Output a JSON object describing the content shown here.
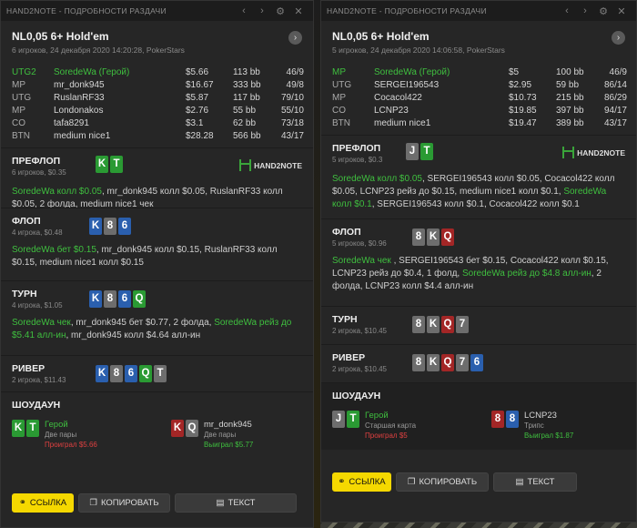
{
  "w1": {
    "title": "HAND2NOTE - ПОДРОБНОСТИ РАЗДАЧИ",
    "game": "NL0,05 6+ Hold'em",
    "meta": "6 игроков, 24 декабря 2020 14:20:28, PokerStars",
    "players": [
      {
        "pos": "UTG2",
        "name": "SoredeWa (Герой)",
        "stack": "$5.66",
        "bb": "113 bb",
        "hands": "46/9",
        "hero": true
      },
      {
        "pos": "MP",
        "name": "mr_donk945",
        "stack": "$16.67",
        "bb": "333 bb",
        "hands": "49/8"
      },
      {
        "pos": "UTG",
        "name": "RuslanRF33",
        "stack": "$5.87",
        "bb": "117 bb",
        "hands": "79/10"
      },
      {
        "pos": "MP",
        "name": "Londonakos",
        "stack": "$2.76",
        "bb": "55 bb",
        "hands": "55/10"
      },
      {
        "pos": "CO",
        "name": "tafa8291",
        "stack": "$3.1",
        "bb": "62 bb",
        "hands": "73/18"
      },
      {
        "pos": "BTN",
        "name": "medium nice1",
        "stack": "$28.28",
        "bb": "566 bb",
        "hands": "43/17"
      }
    ],
    "preflop": {
      "title": "ПРЕФЛОП",
      "sub": "6 игроков, $0.35",
      "a1": "SoredeWa колл $0.05",
      "a2": ", mr_donk945 колл $0.05, RuslanRF33 колл $0.05, 2 фолда, medium nice1 чек"
    },
    "flop": {
      "title": "ФЛОП",
      "sub": "4 игрока, $0.48",
      "a1": "SoredeWa бет $0.15",
      "a2": ", mr_donk945 колл $0.15, RuslanRF33 колл $0.15, medium nice1 колл $0.15"
    },
    "turn": {
      "title": "ТУРН",
      "sub": "4 игрока, $1.05",
      "a1": "SoredeWa чек",
      "a2": ", mr_donk945 бет $0.77, 2 фолда, ",
      "a3": "SoredeWa рейз до $5.41 алл-ин",
      "a4": ", mr_donk945 колл $4.64 алл-ин"
    },
    "river": {
      "title": "РИВЕР",
      "sub": "2 игрока, $11.43"
    },
    "showdown": {
      "title": "ШОУДАУН",
      "p1": {
        "name": "Герой",
        "hand": "Две пары",
        "result": "Проиграл $5.66"
      },
      "p2": {
        "name": "mr_donk945",
        "hand": "Две пары",
        "result": "Выиграл $5.77"
      }
    },
    "buttons": {
      "link": "ССЫЛКА",
      "copy": "КОПИРОВАТЬ",
      "text": "ТЕКСТ"
    }
  },
  "w2": {
    "title": "HAND2NOTE - ПОДРОБНОСТИ РАЗДАЧИ",
    "game": "NL0,05 6+ Hold'em",
    "meta": "5 игроков, 24 декабря 2020 14:06:58, PokerStars",
    "players": [
      {
        "pos": "MP",
        "name": "SoredeWa (Герой)",
        "stack": "$5",
        "bb": "100 bb",
        "hands": "46/9",
        "hero": true
      },
      {
        "pos": "UTG",
        "name": "SERGEI196543",
        "stack": "$2.95",
        "bb": "59 bb",
        "hands": "86/14"
      },
      {
        "pos": "MP",
        "name": "Cocacol422",
        "stack": "$10.73",
        "bb": "215 bb",
        "hands": "86/29"
      },
      {
        "pos": "CO",
        "name": "LCNP23",
        "stack": "$19.85",
        "bb": "397 bb",
        "hands": "94/17"
      },
      {
        "pos": "BTN",
        "name": "medium nice1",
        "stack": "$19.47",
        "bb": "389 bb",
        "hands": "43/17"
      }
    ],
    "preflop": {
      "title": "ПРЕФЛОП",
      "sub": "5 игроков, $0.3",
      "a1": "SoredeWa колл $0.05",
      "a2": ", SERGEI196543 колл $0.05, Cocacol422 колл $0.05, LCNP23 рейз до $0.15, medium nice1 колл $0.1, ",
      "a3": "SoredeWa колл $0.1",
      "a4": ", SERGEI196543 колл $0.1, Cocacol422 колл $0.1"
    },
    "flop": {
      "title": "ФЛОП",
      "sub": "5 игроков, $0.96",
      "a1": "SoredeWa чек",
      "a2": " , SERGEI196543 бет $0.15, Cocacol422 колл $0.15, LCNP23 рейз до $0.4, 1 фолд, ",
      "a3": "SoredeWa рейз до $4.8 алл-ин",
      "a4": ", 2 фолда, LCNP23 колл $4.4 алл-ин"
    },
    "turn": {
      "title": "ТУРН",
      "sub": "2 игрока, $10.45"
    },
    "river": {
      "title": "РИВЕР",
      "sub": "2 игрока, $10.45"
    },
    "showdown": {
      "title": "ШОУДАУН",
      "p1": {
        "name": "Герой",
        "hand": "Старшая карта",
        "result": "Проиграл $5"
      },
      "p2": {
        "name": "LCNP23",
        "hand": "Трипс",
        "result": "Выиграл $1.87"
      }
    },
    "buttons": {
      "link": "ССЫЛКА",
      "copy": "КОПИРОВАТЬ",
      "text": "ТЕКСТ"
    }
  },
  "cards": {
    "w1_pre": [
      {
        "r": "K",
        "c": "g"
      },
      {
        "r": "T",
        "c": "g"
      }
    ],
    "w1_flop": [
      {
        "r": "K",
        "c": "b"
      },
      {
        "r": "8",
        "c": "k"
      },
      {
        "r": "6",
        "c": "b"
      }
    ],
    "w1_turn": [
      {
        "r": "K",
        "c": "b"
      },
      {
        "r": "8",
        "c": "k"
      },
      {
        "r": "6",
        "c": "b"
      },
      {
        "r": "Q",
        "c": "g"
      }
    ],
    "w1_river": [
      {
        "r": "K",
        "c": "b"
      },
      {
        "r": "8",
        "c": "k"
      },
      {
        "r": "6",
        "c": "b"
      },
      {
        "r": "Q",
        "c": "g"
      },
      {
        "r": "T",
        "c": "k"
      }
    ],
    "w1_sd1": [
      {
        "r": "K",
        "c": "g"
      },
      {
        "r": "T",
        "c": "g"
      }
    ],
    "w1_sd2": [
      {
        "r": "K",
        "c": "r"
      },
      {
        "r": "Q",
        "c": "k"
      }
    ],
    "w2_pre": [
      {
        "r": "J",
        "c": "k"
      },
      {
        "r": "T",
        "c": "g"
      }
    ],
    "w2_flop": [
      {
        "r": "8",
        "c": "k"
      },
      {
        "r": "K",
        "c": "k"
      },
      {
        "r": "Q",
        "c": "r"
      }
    ],
    "w2_turn": [
      {
        "r": "8",
        "c": "k"
      },
      {
        "r": "K",
        "c": "k"
      },
      {
        "r": "Q",
        "c": "r"
      },
      {
        "r": "7",
        "c": "k"
      }
    ],
    "w2_river": [
      {
        "r": "8",
        "c": "k"
      },
      {
        "r": "K",
        "c": "k"
      },
      {
        "r": "Q",
        "c": "r"
      },
      {
        "r": "7",
        "c": "k"
      },
      {
        "r": "6",
        "c": "b"
      }
    ],
    "w2_sd1": [
      {
        "r": "J",
        "c": "k"
      },
      {
        "r": "T",
        "c": "g"
      }
    ],
    "w2_sd2": [
      {
        "r": "8",
        "c": "r"
      },
      {
        "r": "8",
        "c": "b"
      }
    ]
  },
  "logo_text": "HAND2NOTE",
  "icons": {
    "back": "chevron-left-icon",
    "forward": "chevron-right-icon",
    "settings": "gear-icon",
    "close": "close-icon",
    "link": "link-icon",
    "copy": "copy-icon",
    "text": "document-icon",
    "next": "chevron-right-icon"
  }
}
